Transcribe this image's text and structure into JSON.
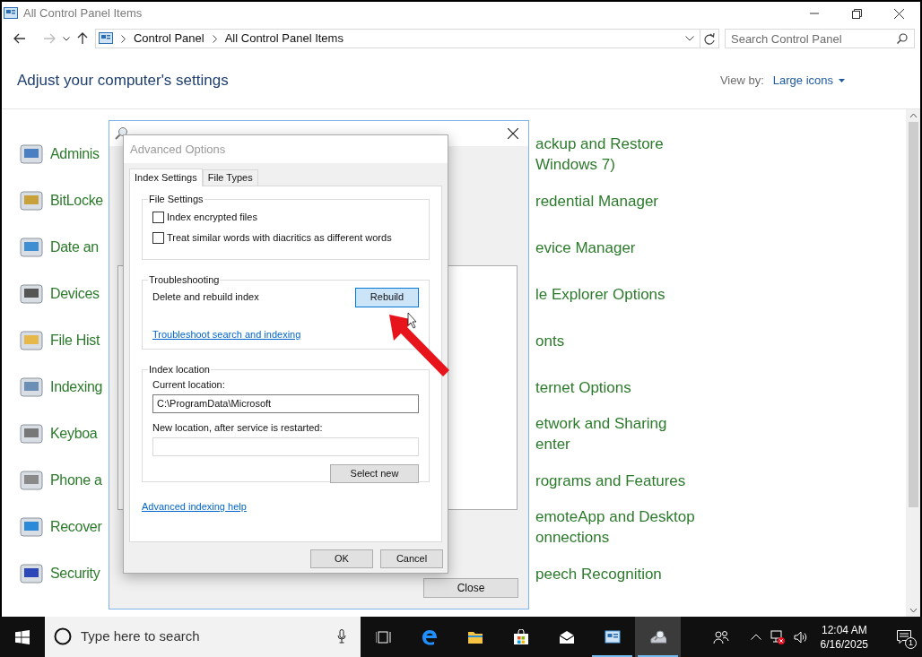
{
  "window": {
    "title": "All Control Panel Items"
  },
  "address_bar": {
    "path": [
      "Control Panel",
      "All Control Panel Items"
    ],
    "search_placeholder": "Search Control Panel"
  },
  "heading": "Adjust your computer's settings",
  "view_by": {
    "label": "View by:",
    "value": "Large icons"
  },
  "items_left": [
    "Adminis",
    "BitLocke",
    "Date an",
    "Devices",
    "File Hist",
    "Indexing",
    "Keyboa",
    "Phone a",
    "Recover",
    "Security"
  ],
  "items_right": [
    {
      "lines": [
        "ackup and Restore",
        "Windows 7)"
      ]
    },
    {
      "lines": [
        "redential Manager"
      ]
    },
    {
      "lines": [
        "evice Manager"
      ]
    },
    {
      "lines": [
        "le Explorer Options"
      ]
    },
    {
      "lines": [
        "onts"
      ]
    },
    {
      "lines": [
        "ternet Options"
      ]
    },
    {
      "lines": [
        "etwork and Sharing",
        "enter"
      ]
    },
    {
      "lines": [
        "rograms and Features"
      ]
    },
    {
      "lines": [
        "emoteApp and Desktop",
        "onnections"
      ]
    },
    {
      "lines": [
        "peech Recognition"
      ]
    }
  ],
  "indexing_window": {
    "close_button": "Close"
  },
  "advanced_dialog": {
    "title": "Advanced Options",
    "tabs": [
      {
        "label": "Index Settings",
        "selected": true
      },
      {
        "label": "File Types",
        "selected": false
      }
    ],
    "file_settings": {
      "legend": "File Settings",
      "options": [
        {
          "label": "Index encrypted files",
          "checked": false
        },
        {
          "label": "Treat similar words with diacritics as different words",
          "checked": false
        }
      ]
    },
    "troubleshooting": {
      "legend": "Troubleshooting",
      "description": "Delete and rebuild index",
      "button": "Rebuild",
      "link": "Troubleshoot search and indexing"
    },
    "index_location": {
      "legend": "Index location",
      "current_label": "Current location:",
      "current_value": "C:\\ProgramData\\Microsoft",
      "new_label": "New location, after service is restarted:",
      "button": "Select new"
    },
    "help_link": "Advanced indexing help",
    "buttons": [
      "OK",
      "Cancel"
    ]
  },
  "taskbar": {
    "search_placeholder": "Type here to search",
    "apps": [
      {
        "kind": "taskview",
        "running": false,
        "selected": false
      },
      {
        "kind": "edge",
        "running": false,
        "selected": false
      },
      {
        "kind": "explorer",
        "running": false,
        "selected": false
      },
      {
        "kind": "store",
        "running": false,
        "selected": false
      },
      {
        "kind": "mail",
        "running": false,
        "selected": false
      },
      {
        "kind": "controlpanel",
        "running": true,
        "selected": false
      },
      {
        "kind": "indexing",
        "running": true,
        "selected": true
      }
    ],
    "time": "12:04 AM",
    "date": "6/16/2025",
    "notification_count": "1"
  }
}
